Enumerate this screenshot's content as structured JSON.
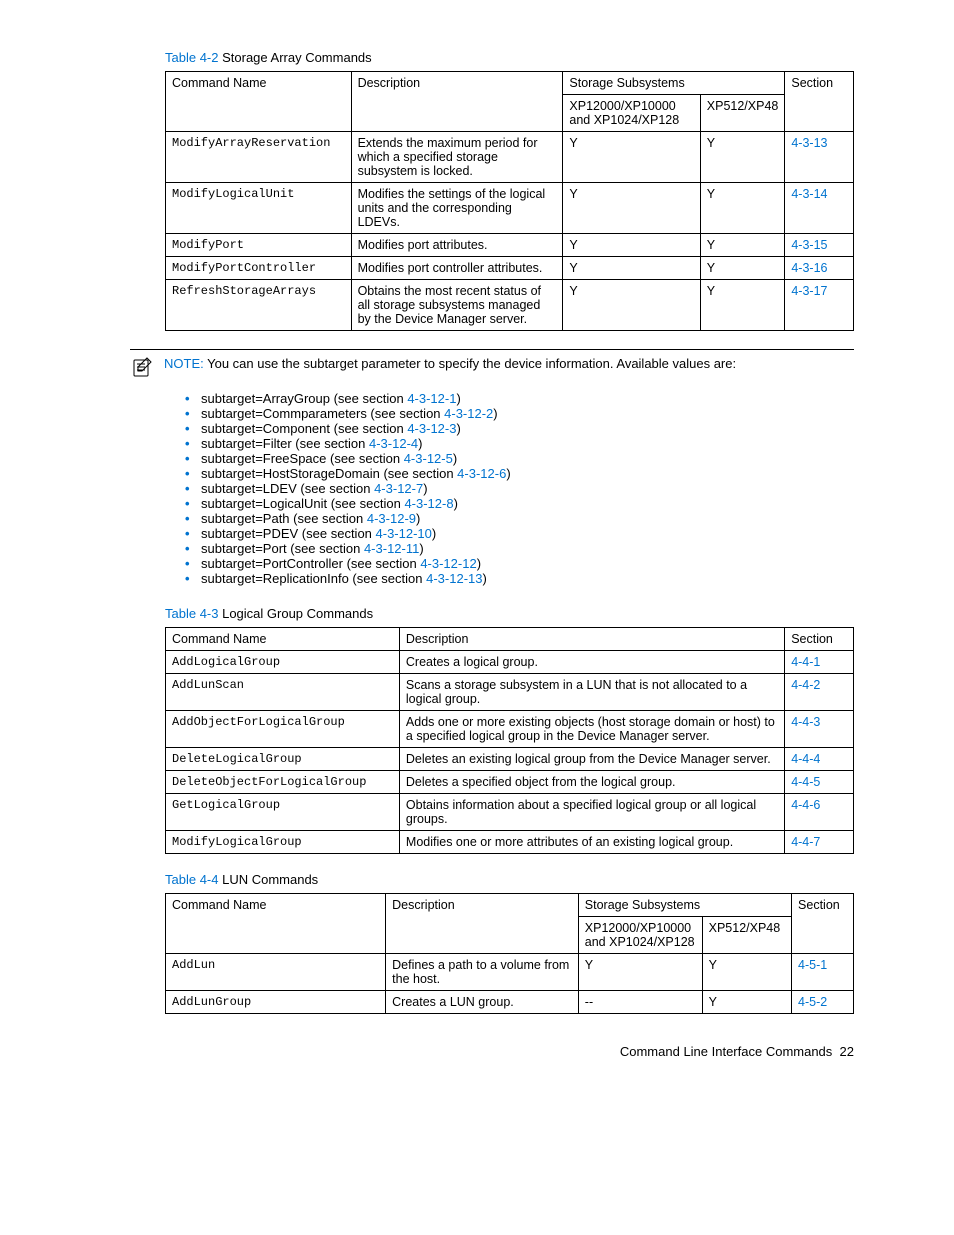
{
  "table42": {
    "num": "Table 4-2",
    "title": " Storage Array Commands",
    "headers": {
      "cmd": "Command Name",
      "desc": "Description",
      "subs": "Storage Subsystems",
      "sec": "Section",
      "sub1": "XP12000/XP10000 and XP1024/XP128",
      "sub2": "XP512/XP48"
    },
    "rows": [
      {
        "cmd": "ModifyArrayReservation",
        "desc": "Extends the maximum period for which a specified storage subsystem is locked.",
        "s1": "Y",
        "s2": "Y",
        "sec": "4-3-13"
      },
      {
        "cmd": "ModifyLogicalUnit",
        "desc": "Modifies the settings of the logical units and the corresponding LDEVs.",
        "s1": "Y",
        "s2": "Y",
        "sec": "4-3-14"
      },
      {
        "cmd": "ModifyPort",
        "desc": "Modifies port attributes.",
        "s1": "Y",
        "s2": "Y",
        "sec": "4-3-15"
      },
      {
        "cmd": "ModifyPortController",
        "desc": "Modifies port controller attributes.",
        "s1": "Y",
        "s2": "Y",
        "sec": "4-3-16"
      },
      {
        "cmd": "RefreshStorageArrays",
        "desc": "Obtains the most recent status of all storage subsystems managed by the Device Manager server.",
        "s1": "Y",
        "s2": "Y",
        "sec": "4-3-17"
      }
    ]
  },
  "note": {
    "label": "NOTE:",
    "text": " You can use the subtarget parameter to specify the device information. Available values are:"
  },
  "subtargets": [
    {
      "pre": "subtarget=ArrayGroup (see section ",
      "link": "4-3-12-1",
      "post": ")"
    },
    {
      "pre": "subtarget=Commparameters (see section ",
      "link": "4-3-12-2",
      "post": ")"
    },
    {
      "pre": "subtarget=Component (see section ",
      "link": "4-3-12-3",
      "post": ")"
    },
    {
      "pre": "subtarget=Filter (see section ",
      "link": "4-3-12-4",
      "post": ")"
    },
    {
      "pre": "subtarget=FreeSpace (see section ",
      "link": "4-3-12-5",
      "post": ")"
    },
    {
      "pre": "subtarget=HostStorageDomain (see section ",
      "link": "4-3-12-6",
      "post": ")"
    },
    {
      "pre": "subtarget=LDEV (see section ",
      "link": "4-3-12-7",
      "post": ")"
    },
    {
      "pre": "subtarget=LogicalUnit (see section ",
      "link": "4-3-12-8",
      "post": ")"
    },
    {
      "pre": "subtarget=Path (see section ",
      "link": "4-3-12-9",
      "post": ")"
    },
    {
      "pre": "subtarget=PDEV (see section ",
      "link": "4-3-12-10",
      "post": ")"
    },
    {
      "pre": "subtarget=Port (see section ",
      "link": "4-3-12-11",
      "post": ")"
    },
    {
      "pre": "subtarget=PortController (see section ",
      "link": "4-3-12-12",
      "post": ")"
    },
    {
      "pre": "subtarget=ReplicationInfo (see section ",
      "link": "4-3-12-13",
      "post": ")"
    }
  ],
  "table43": {
    "num": "Table 4-3",
    "title": " Logical Group Commands",
    "headers": {
      "cmd": "Command Name",
      "desc": "Description",
      "sec": "Section"
    },
    "rows": [
      {
        "cmd": "AddLogicalGroup",
        "desc": "Creates a logical group.",
        "sec": "4-4-1"
      },
      {
        "cmd": "AddLunScan",
        "desc": "Scans a storage subsystem in a LUN that is not allocated to a logical group.",
        "sec": "4-4-2"
      },
      {
        "cmd": "AddObjectForLogicalGroup",
        "desc": "Adds one or more existing objects (host storage domain or host) to a specified logical group in the Device Manager server.",
        "sec": "4-4-3"
      },
      {
        "cmd": "DeleteLogicalGroup",
        "desc": "Deletes an existing logical group from the Device Manager server.",
        "sec": "4-4-4"
      },
      {
        "cmd": "DeleteObjectForLogicalGroup",
        "desc": "Deletes a specified object from the logical group.",
        "sec": "4-4-5"
      },
      {
        "cmd": "GetLogicalGroup",
        "desc": "Obtains information about a specified logical group or all logical groups.",
        "sec": "4-4-6"
      },
      {
        "cmd": "ModifyLogicalGroup",
        "desc": "Modifies one or more attributes of an existing logical group.",
        "sec": "4-4-7"
      }
    ]
  },
  "table44": {
    "num": "Table 4-4",
    "title": " LUN Commands",
    "headers": {
      "cmd": "Command Name",
      "desc": "Description",
      "subs": "Storage Subsystems",
      "sec": "Section",
      "sub1": "XP12000/XP10000 and XP1024/XP128",
      "sub2": "XP512/XP48"
    },
    "rows": [
      {
        "cmd": "AddLun",
        "desc": "Defines a path to a volume from the host.",
        "s1": "Y",
        "s2": "Y",
        "sec": "4-5-1"
      },
      {
        "cmd": "AddLunGroup",
        "desc": "Creates a LUN group.",
        "s1": "--",
        "s2": "Y",
        "sec": "4-5-2"
      }
    ]
  },
  "footer": {
    "title": "Command Line Interface Commands",
    "page": "22"
  }
}
